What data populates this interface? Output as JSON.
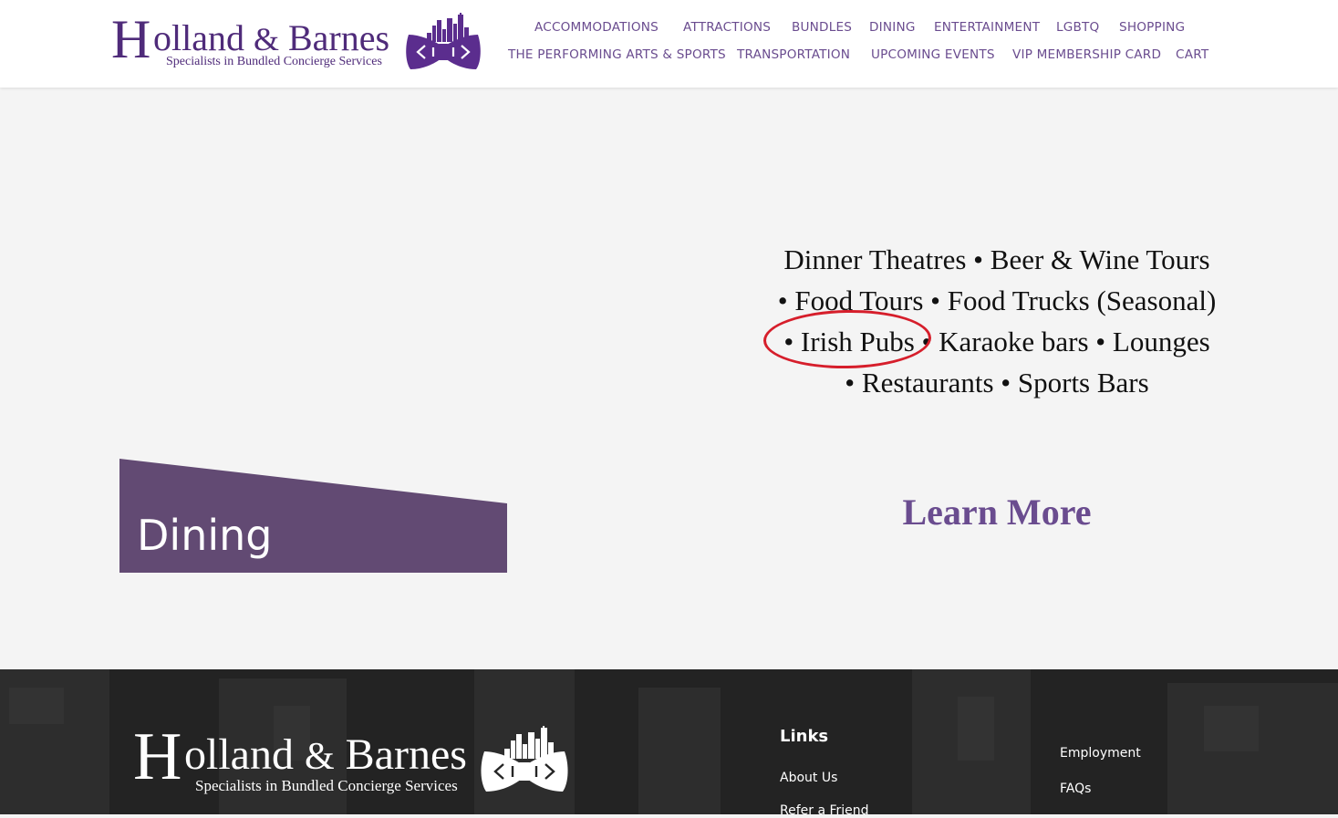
{
  "header": {
    "logo": {
      "initial": "H",
      "name_rest": "olland",
      "amp": "&",
      "name_second": "Barnes",
      "tagline": "Specialists in Bundled Concierge Services"
    },
    "nav_row1": [
      "ACCOMMODATIONS",
      "ATTRACTIONS",
      "BUNDLES",
      "DINING",
      "ENTERTAINMENT",
      "LGBTQ",
      "SHOPPING"
    ],
    "nav_row2": [
      "THE PERFORMING ARTS & SPORTS",
      "TRANSPORTATION",
      "UPCOMING EVENTS",
      "VIP MEMBERSHIP CARD",
      "CART"
    ]
  },
  "main": {
    "list_lines": [
      "Dinner Theatres • Beer & Wine Tours",
      "• Food Tours • Food Trucks (Seasonal)",
      "• Irish Pubs • Karaoke bars • Lounges",
      "• Restaurants • Sports Bars"
    ],
    "learn_more": "Learn More",
    "banner_title": "Dining"
  },
  "footer": {
    "logo": {
      "initial": "H",
      "name_rest": "olland",
      "amp": "&",
      "name_second": "Barnes",
      "tagline": "Specialists in Bundled Concierge Services"
    },
    "links_heading": "Links",
    "links_col1": [
      "About Us",
      "Refer a Friend"
    ],
    "links_col2": [
      "Employment",
      "FAQs"
    ]
  },
  "colors": {
    "brand_purple": "#4f2b7a",
    "nav_purple": "#6a4c8f",
    "banner_purple": "#624a73",
    "annotation_red": "#d61e2b",
    "footer_bg": "#252525"
  }
}
